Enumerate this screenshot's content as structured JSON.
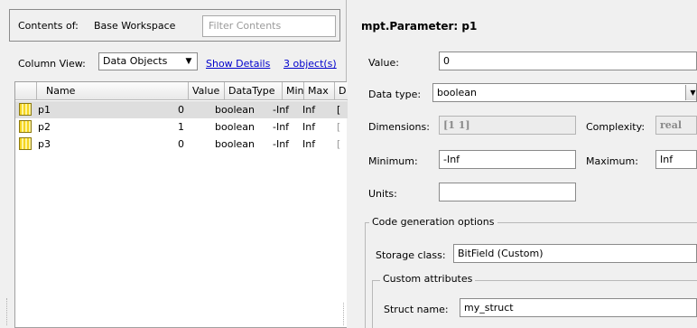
{
  "workspace": {
    "contents_label": "Contents of:",
    "workspace_name": "Base Workspace",
    "filter_placeholder": "Filter Contents",
    "column_view_label": "Column View:",
    "column_view_value": "Data Objects",
    "show_details_link": "Show Details",
    "object_count_link": "3 object(s)",
    "columns": [
      "Name",
      "Value",
      "DataType",
      "Min",
      "Max",
      "D"
    ],
    "rows": [
      {
        "name": "p1",
        "value": "0",
        "datatype": "boolean",
        "min": "-Inf",
        "max": "Inf",
        "d": "[",
        "selected": true
      },
      {
        "name": "p2",
        "value": "1",
        "datatype": "boolean",
        "min": "-Inf",
        "max": "Inf",
        "d": "[",
        "selected": false
      },
      {
        "name": "p3",
        "value": "0",
        "datatype": "boolean",
        "min": "-Inf",
        "max": "Inf",
        "d": "[",
        "selected": false
      }
    ]
  },
  "parameter": {
    "title": "mpt.Parameter: p1",
    "value_label": "Value:",
    "value": "0",
    "datatype_label": "Data type:",
    "datatype": "boolean",
    "dimensions_label": "Dimensions:",
    "dimensions": "[1 1]",
    "complexity_label": "Complexity:",
    "complexity": "real",
    "minimum_label": "Minimum:",
    "minimum": "-Inf",
    "maximum_label": "Maximum:",
    "maximum": "Inf",
    "units_label": "Units:",
    "units": "",
    "code_gen_legend": "Code generation options",
    "storage_class_label": "Storage class:",
    "storage_class": "BitField (Custom)",
    "custom_attributes_legend": "Custom attributes",
    "struct_name_label": "Struct name:",
    "struct_name": "my_struct"
  },
  "icons": {
    "data_object": "parameter-object-icon",
    "dropdown": "dropdown-arrow-icon"
  }
}
